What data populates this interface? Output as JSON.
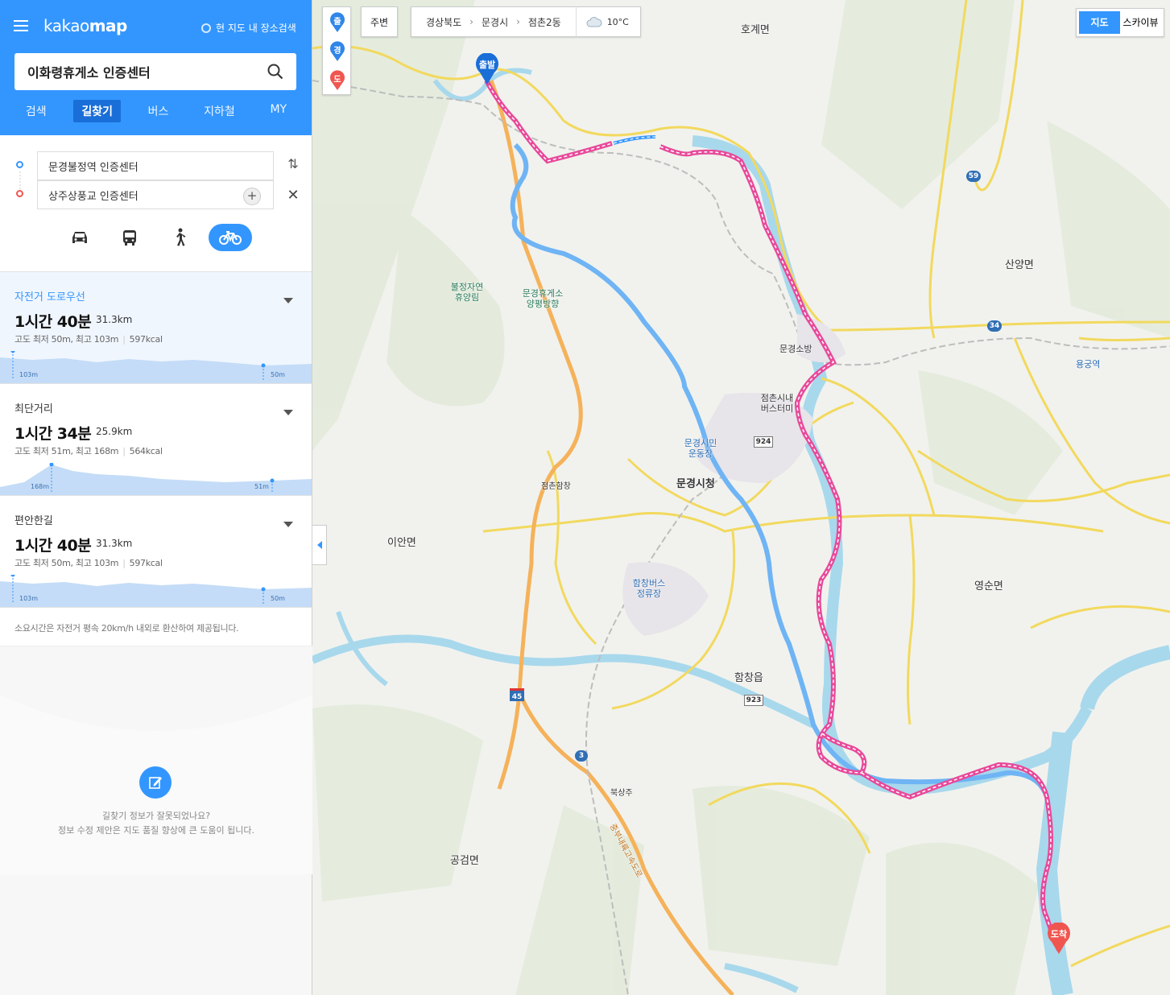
{
  "app": {
    "logo_light": "kakao",
    "logo_bold": "map",
    "map_search": "현 지도 내 장소검색"
  },
  "search": {
    "value": "이화령휴게소 인증센터"
  },
  "tabs": [
    "검색",
    "길찾기",
    "버스",
    "지하철",
    "MY"
  ],
  "active_tab": "길찾기",
  "route_inputs": {
    "origin": "문경불정역 인증센터",
    "destination": "상주상풍교 인증센터"
  },
  "travel_modes": [
    "car-icon",
    "bus-icon",
    "walk-icon",
    "bike-icon"
  ],
  "active_mode": "bike-icon",
  "routes": [
    {
      "name": "자전거 도로우선",
      "time": "1시간 40분",
      "distance": "31.3km",
      "info": "고도 최저 50m, 최고 103m",
      "kcal": "597kcal",
      "elev_high": "103m",
      "elev_low": "50m",
      "selected": true
    },
    {
      "name": "최단거리",
      "time": "1시간 34분",
      "distance": "25.9km",
      "info": "고도 최저 51m, 최고 168m",
      "kcal": "564kcal",
      "elev_high": "168m",
      "elev_low": "51m",
      "selected": false
    },
    {
      "name": "편안한길",
      "time": "1시간 40분",
      "distance": "31.3km",
      "info": "고도 최저 50m, 최고 103m",
      "kcal": "597kcal",
      "elev_high": "103m",
      "elev_low": "50m",
      "selected": false
    }
  ],
  "note": "소요시간은 자전거 평속 20km/h 내외로 환산하여 제공됩니다.",
  "feedback": {
    "line1": "길찾기 정보가 잘못되었나요?",
    "line2": "정보 수정 제안은 지도 품질 향상에 큰 도움이 됩니다."
  },
  "map": {
    "pin_buttons": [
      "출",
      "경",
      "도"
    ],
    "nearby": "주변",
    "breadcrumb": [
      "경상북도",
      "문경시",
      "점촌2동"
    ],
    "weather": "10°C",
    "map_types": [
      "지도",
      "스카이뷰"
    ],
    "active_map_type": "지도",
    "start_label": "출발",
    "end_label": "도착",
    "places": [
      "호계면",
      "산양면",
      "이안면",
      "영순면",
      "함창읍",
      "공검면",
      "문경시청",
      "불정자연 휴양림",
      "문경휴게소 양평방향",
      "문경소방",
      "점촌시내 버스터미",
      "점촌함창",
      "함창버스 정류장",
      "북상주",
      "용궁역",
      "문경시민 운동장",
      "중부내륙고속도로"
    ],
    "road_numbers": [
      "59",
      "34",
      "924",
      "923",
      "45",
      "3"
    ]
  },
  "colors": {
    "brand": "#3396ff",
    "bike_route": "#e8499a",
    "alt_route": "#6fb4f4",
    "river": "#a8d8ec"
  }
}
